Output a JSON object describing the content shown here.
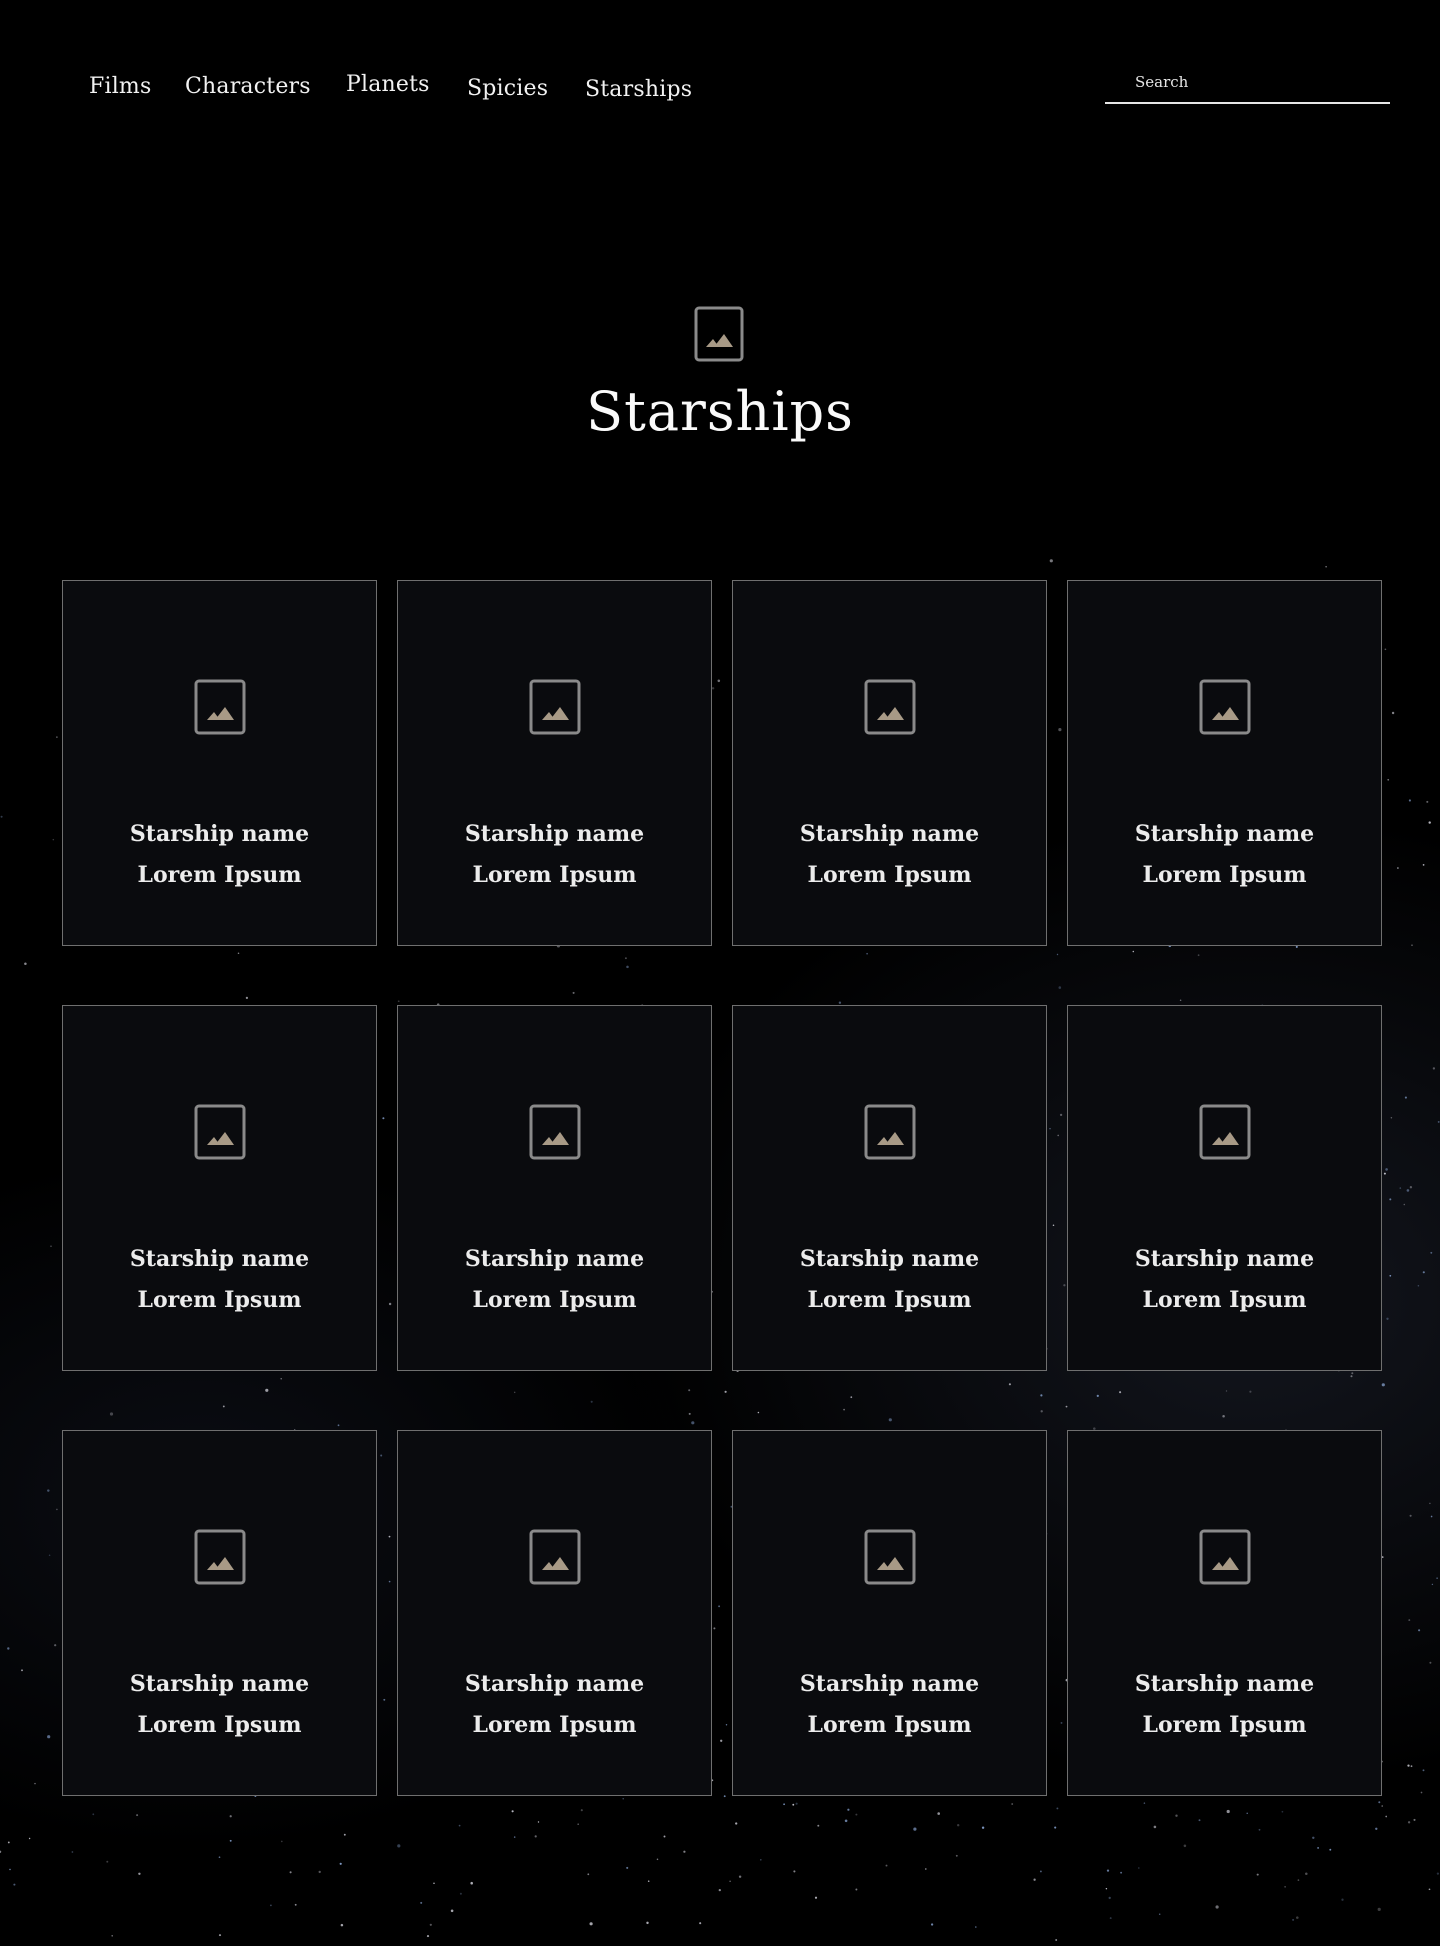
{
  "nav": {
    "items": [
      {
        "label": "Films"
      },
      {
        "label": "Characters"
      },
      {
        "label": "Planets"
      },
      {
        "label": "Spicies"
      },
      {
        "label": "Starships"
      }
    ],
    "search": {
      "placeholder": "Search"
    }
  },
  "page": {
    "title": "Starships",
    "hero_icon": "image-placeholder-icon"
  },
  "colors": {
    "background": "#000000",
    "card_background": "#0a0b0e",
    "card_border": "#6f6f6f",
    "icon_frame": "#8a8a8a",
    "icon_mountain": "#a89a86"
  },
  "cards": [
    {
      "name": "Starship name",
      "sub": "Lorem Ipsum",
      "icon": "image-placeholder-icon"
    },
    {
      "name": "Starship name",
      "sub": "Lorem Ipsum",
      "icon": "image-placeholder-icon"
    },
    {
      "name": "Starship name",
      "sub": "Lorem Ipsum",
      "icon": "image-placeholder-icon"
    },
    {
      "name": "Starship name",
      "sub": "Lorem Ipsum",
      "icon": "image-placeholder-icon"
    },
    {
      "name": "Starship name",
      "sub": "Lorem Ipsum",
      "icon": "image-placeholder-icon"
    },
    {
      "name": "Starship name",
      "sub": "Lorem Ipsum",
      "icon": "image-placeholder-icon"
    },
    {
      "name": "Starship name",
      "sub": "Lorem Ipsum",
      "icon": "image-placeholder-icon"
    },
    {
      "name": "Starship name",
      "sub": "Lorem Ipsum",
      "icon": "image-placeholder-icon"
    },
    {
      "name": "Starship name",
      "sub": "Lorem Ipsum",
      "icon": "image-placeholder-icon"
    },
    {
      "name": "Starship name",
      "sub": "Lorem Ipsum",
      "icon": "image-placeholder-icon"
    },
    {
      "name": "Starship name",
      "sub": "Lorem Ipsum",
      "icon": "image-placeholder-icon"
    },
    {
      "name": "Starship name",
      "sub": "Lorem Ipsum",
      "icon": "image-placeholder-icon"
    }
  ]
}
